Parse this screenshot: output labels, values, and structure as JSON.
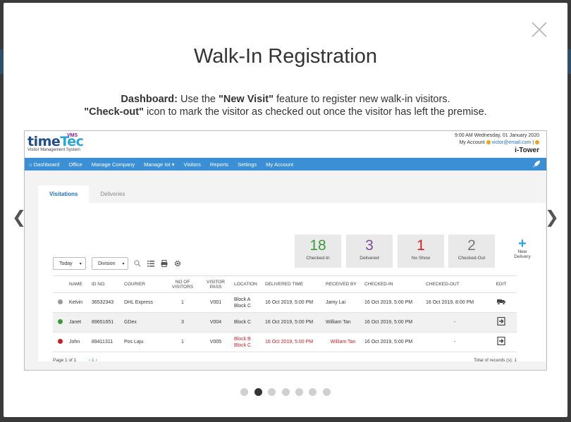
{
  "modal": {
    "title": "Walk-In Registration",
    "line1_bold": "Dashboard:",
    "line1_a": " Use the ",
    "line1_bold2": "\"New Visit\"",
    "line1_b": " feature to register new walk-in visitors.",
    "line2_bold": "\"Check-out\"",
    "line2_rest": " icon to mark the visitor as checked out once the visitor has left the premise.",
    "prev_arrow": "❮",
    "next_arrow": "❯",
    "dots_count": 7,
    "active_dot": 2
  },
  "app": {
    "logo_main_a": "time",
    "logo_main_b": "Tec",
    "logo_vms": "VMS",
    "logo_sub": "Visitor Management System",
    "datetime": "9:00 AM Wednesday, 01 January 2020",
    "my_account_label": "My Account",
    "email": "victor@email.com",
    "separator": "|",
    "tower": "i-Tower",
    "nav": [
      "Dashboard",
      "Office",
      "Manage Company",
      "Manage Iot",
      "Visitors",
      "Reports",
      "Settings",
      "My Account"
    ],
    "tabs": [
      "Visitations",
      "Deliveries"
    ],
    "stats": [
      {
        "num": "18",
        "label": "Checked-In",
        "color": "#3d9a3d"
      },
      {
        "num": "3",
        "label": "Delivered",
        "color": "#7b4f96"
      },
      {
        "num": "1",
        "label": "No Show",
        "color": "#cc1f1f"
      },
      {
        "num": "2",
        "label": "Checked-Out",
        "color": "#777777"
      }
    ],
    "new_delivery_a": "New",
    "new_delivery_b": "Delivery",
    "filter_today": "Today",
    "filter_division": "Division",
    "columns": [
      "",
      "NAME",
      "ID NO.",
      "COURIER",
      "NO OF VISITORS",
      "VISITOR PASS",
      "LOCATION",
      "DELIVERED TIME",
      "RECEIVED BY",
      "CHECKED-IN",
      "CHECKED-OUT",
      "EDIT"
    ],
    "rows": [
      {
        "status_color": "#9a9a9a",
        "name": "Kelvin",
        "id": "36532343",
        "courier": "DHL Express",
        "visitors": "1",
        "pass": "V001",
        "location": "Block A Block C",
        "delivered": "16 Oct 2019, 5:00 PM",
        "received": "Jamy Lai",
        "checkin": "16 Oct 2019, 5:00 PM",
        "checkout": "16 Oct 2019, 8:00 PM",
        "edit_icon": "delivery-truck-icon",
        "red": false
      },
      {
        "status_color": "#3d9a3d",
        "name": "Janet",
        "id": "89651651",
        "courier": "GDex",
        "visitors": "3",
        "pass": "V004",
        "location": "Block C",
        "delivered": "16 Oct 2019, 5:00 PM",
        "received": "William Tan",
        "checkin": "16 Oct 2019, 5:00 PM",
        "checkout": "-",
        "edit_icon": "check-out-icon",
        "red": false
      },
      {
        "status_color": "#cc1f1f",
        "name": "John",
        "id": "89411311",
        "courier": "Pos Laju",
        "visitors": "1",
        "pass": "V005",
        "location": "Block B Block C",
        "delivered": "16 Oct 2019, 5:00 PM",
        "received": "William Tan",
        "checkin": "16 Oct 2019, 5:00 PM",
        "checkout": "-",
        "edit_icon": "check-out-icon",
        "red": true
      }
    ],
    "page_info": "Page 1 of 1",
    "pager": "‹ 1 ›",
    "total": "Total of records (s): 1"
  }
}
